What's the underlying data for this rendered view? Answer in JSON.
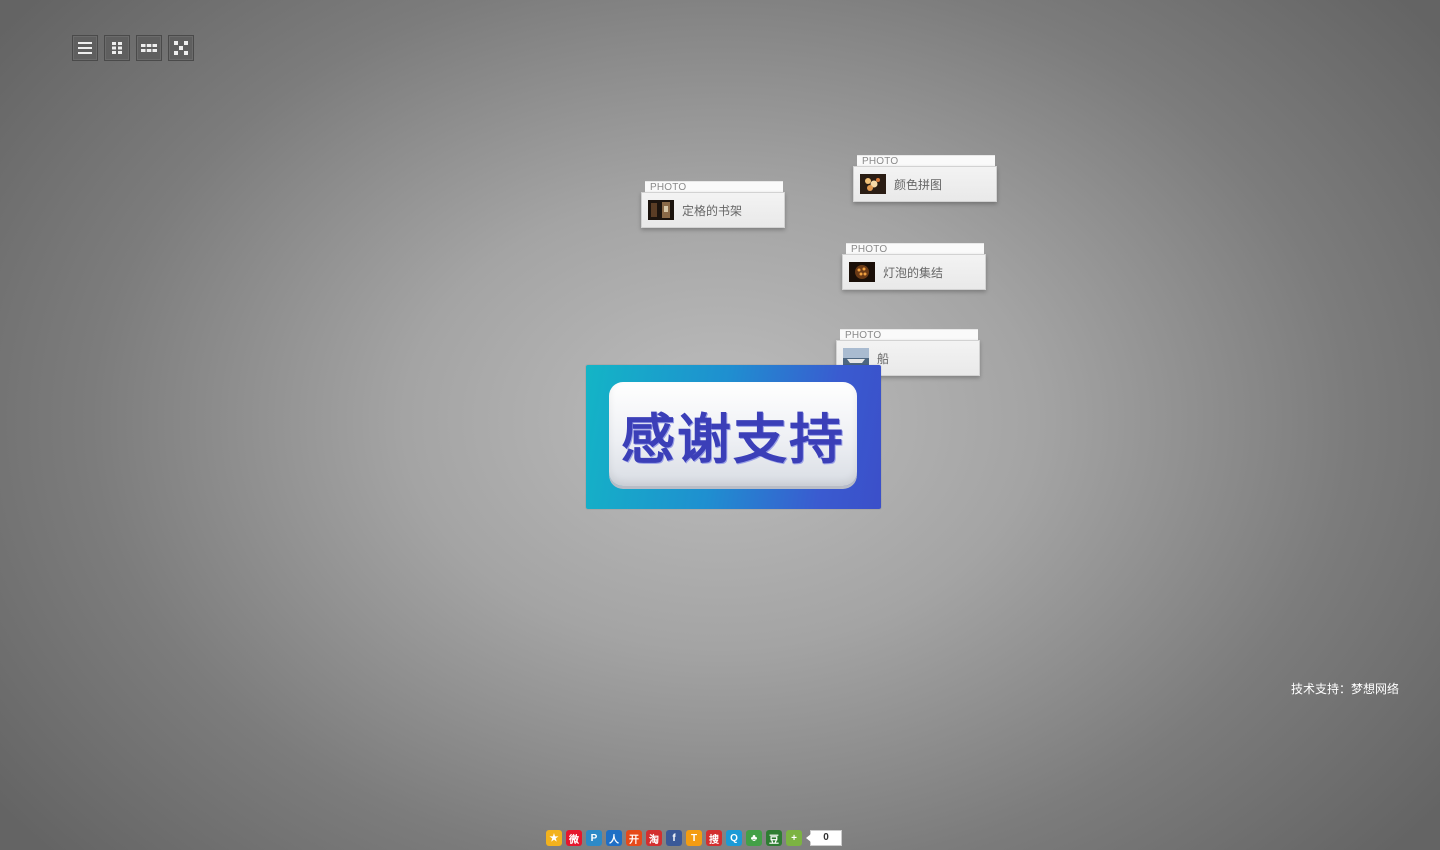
{
  "view_switcher": [
    {
      "icon": "list-view-icon"
    },
    {
      "icon": "grid-small-view-icon"
    },
    {
      "icon": "grid-wide-view-icon"
    },
    {
      "icon": "scatter-view-icon"
    }
  ],
  "cards": [
    {
      "tab": "PHOTO",
      "title": "定格的书架",
      "thumb_color": "#2a1e16"
    },
    {
      "tab": "PHOTO",
      "title": "颜色拼图",
      "thumb_color": "#3a2a20"
    },
    {
      "tab": "PHOTO",
      "title": "灯泡的集结",
      "thumb_color": "#2b1a0e"
    },
    {
      "tab": "PHOTO",
      "title": "船",
      "thumb_color": "#7b8fa8"
    }
  ],
  "banner": {
    "text": "感谢支持"
  },
  "footer": {
    "tech_support": "技术支持：梦想网络"
  },
  "share": {
    "icons": [
      {
        "name": "qzone-share-icon",
        "color": "#f2b21d",
        "glyph": "★"
      },
      {
        "name": "weibo-share-icon",
        "color": "#e6162d",
        "glyph": "微"
      },
      {
        "name": "pengyou-share-icon",
        "color": "#2d8ac7",
        "glyph": "P"
      },
      {
        "name": "renren-share-icon",
        "color": "#1f6fc5",
        "glyph": "人"
      },
      {
        "name": "kaixin-share-icon",
        "color": "#e64a19",
        "glyph": "开"
      },
      {
        "name": "taobao-share-icon",
        "color": "#d32f2f",
        "glyph": "淘"
      },
      {
        "name": "facebook-share-icon",
        "color": "#3b5998",
        "glyph": "f"
      },
      {
        "name": "tqq-share-icon",
        "color": "#f39c12",
        "glyph": "T"
      },
      {
        "name": "sohu-share-icon",
        "color": "#d32f2f",
        "glyph": "搜"
      },
      {
        "name": "qq-share-icon",
        "color": "#1b9ad6",
        "glyph": "Q"
      },
      {
        "name": "clover-share-icon",
        "color": "#43a047",
        "glyph": "♣"
      },
      {
        "name": "douban-share-icon",
        "color": "#2e7d32",
        "glyph": "豆"
      },
      {
        "name": "more-share-icon",
        "color": "#7cb342",
        "glyph": "+"
      }
    ],
    "count": "0"
  }
}
